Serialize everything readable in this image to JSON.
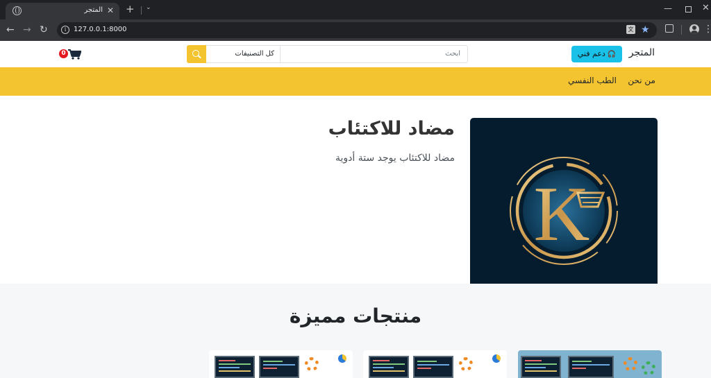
{
  "browser": {
    "tab_title": "المتجر",
    "tab_close": "✕",
    "new_tab": "+",
    "tab_search": "⌄",
    "url": "127.0.0.1:8000",
    "info_glyph": "i",
    "translate_glyph": "文",
    "window_minimize": "—",
    "window_close": "✕",
    "back": "←",
    "forward": "→",
    "reload": "↻",
    "star": "★",
    "menu": "⋮"
  },
  "header": {
    "brand": "المتجر",
    "support_label": "دعم فني",
    "search_placeholder": "ابحث",
    "category_selected": "كل التصنيفات",
    "cart_count": "0"
  },
  "nav": {
    "items": [
      "من نحن",
      "الطب النفسي"
    ]
  },
  "hero": {
    "title": "مضاد للاكتئاب",
    "description": "مضاد للاكتئاب يوجد ستة أدوية",
    "logo_letter": "K"
  },
  "featured": {
    "title": "منتجات مميزة"
  },
  "colors": {
    "accent_yellow": "#f4c430",
    "support_cyan": "#19c1e8",
    "badge_red": "#e4181f",
    "hero_bg": "#041c2d",
    "logo_gold": "#d4a65a"
  },
  "icons": {
    "cart": "cart-icon",
    "search": "search-icon",
    "support": "headset-icon"
  }
}
